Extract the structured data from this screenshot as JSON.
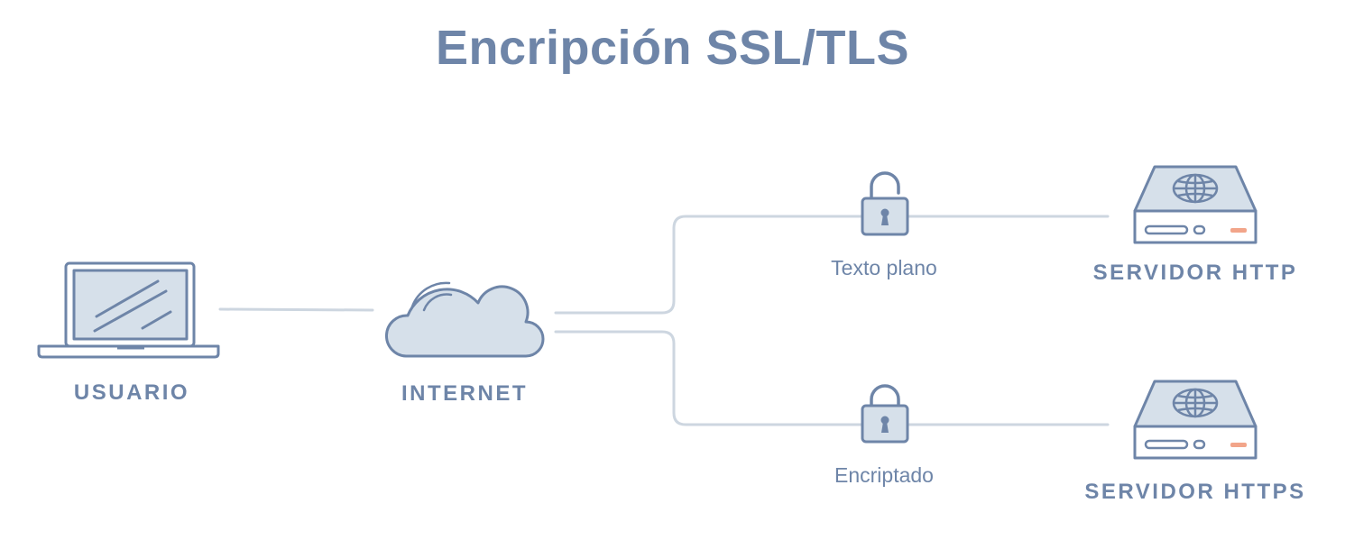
{
  "title": "Encripción SSL/TLS",
  "nodes": {
    "user": "USUARIO",
    "internet": "INTERNET",
    "http_server": "SERVIDOR HTTP",
    "https_server": "SERVIDOR HTTPS"
  },
  "paths": {
    "plain": "Texto plano",
    "encrypted": "Encriptado"
  },
  "icons": [
    "laptop-icon",
    "cloud-icon",
    "unlocked-padlock-icon",
    "locked-padlock-icon",
    "server-icon"
  ],
  "colors": {
    "ink": "#6e85a8",
    "fill": "#d6e0ea",
    "line": "#cdd6e0",
    "led": "#f2a58a"
  }
}
